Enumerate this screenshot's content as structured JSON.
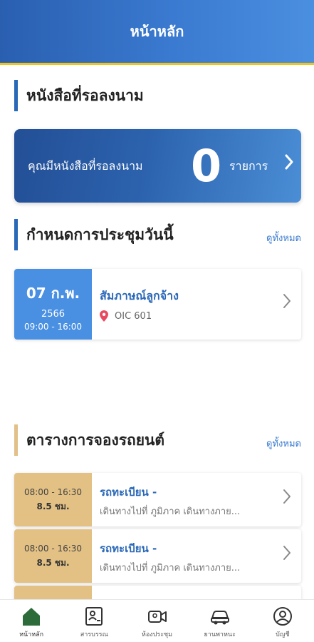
{
  "header": {
    "title": "หน้าหลัก"
  },
  "pending_section": {
    "title": "หนังสือที่รอลงนาม"
  },
  "pending_card": {
    "label": "คุณมีหนังสือที่รอลงนาม",
    "count": "0",
    "unit": "รายการ"
  },
  "meeting_section": {
    "title": "กำหนดการประชุมวันนี้",
    "see_all": "ดูทั้งหมด"
  },
  "meetings": [
    {
      "date": "07 ก.พ.",
      "year": "2566",
      "time": "09:00 - 16:00",
      "title": "สัมภาษณ์ลูกจ้าง",
      "room": "OIC 601"
    }
  ],
  "car_section": {
    "title": "ตารางการจองรถยนต์",
    "see_all": "ดูทั้งหมด"
  },
  "car_bookings": [
    {
      "time": "08:00 - 16:30",
      "hours": "8.5 ชม.",
      "title": "รถทะเบียน -",
      "desc": "เดินทางไปที่ ภูมิภาค เดินทางภาย..."
    },
    {
      "time": "08:00 - 16:30",
      "hours": "8.5 ชม.",
      "title": "รถทะเบียน -",
      "desc": "เดินทางไปที่ ภูมิภาค เดินทางภาย..."
    }
  ],
  "nav": {
    "home": "หน้าหลัก",
    "saraban": "สารบรรณ",
    "meeting_room": "ห้องประชุม",
    "vehicle": "ยานพาหนะ",
    "account": "บัญชี"
  },
  "colors": {
    "accent": "#2a68b8",
    "gold": "#e3c184",
    "date_blue": "#4a90e2",
    "active_icon": "#2e6b3a"
  }
}
